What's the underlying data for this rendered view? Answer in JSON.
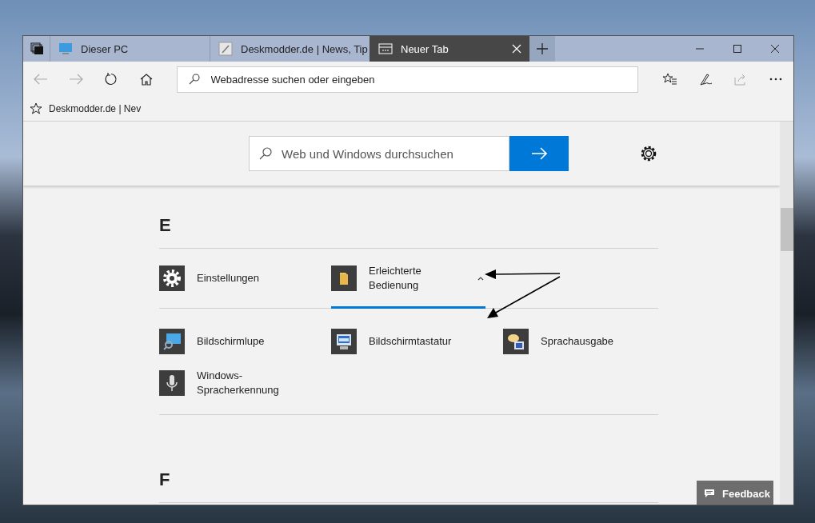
{
  "tabs": [
    {
      "label": "Dieser PC",
      "kind": "pc",
      "selected": false
    },
    {
      "label": "Deskmodder.de | News, Tip",
      "kind": "site",
      "selected": false
    },
    {
      "label": "Neuer Tab",
      "kind": "newtab",
      "selected": true
    }
  ],
  "address_bar": {
    "placeholder": "Webadresse suchen oder eingeben"
  },
  "favorites": [
    {
      "label": "Deskmodder.de | Nev"
    }
  ],
  "search": {
    "placeholder": "Web und Windows durchsuchen"
  },
  "sections": [
    {
      "letter": "E",
      "items": [
        {
          "label": "Einstellungen",
          "kind": "gear"
        },
        {
          "label": "Erleichterte Bedienung",
          "kind": "folder",
          "expanded": true,
          "children": [
            {
              "label": "Bildschirmlupe",
              "kind": "magnifier"
            },
            {
              "label": "Bildschirmtastatur",
              "kind": "keyboard"
            },
            {
              "label": "Sprachausgabe",
              "kind": "speech"
            },
            {
              "label": "Windows-Spracherkennung",
              "kind": "microphone"
            }
          ]
        }
      ]
    },
    {
      "letter": "F"
    }
  ],
  "feedback": {
    "label": "Feedback"
  }
}
